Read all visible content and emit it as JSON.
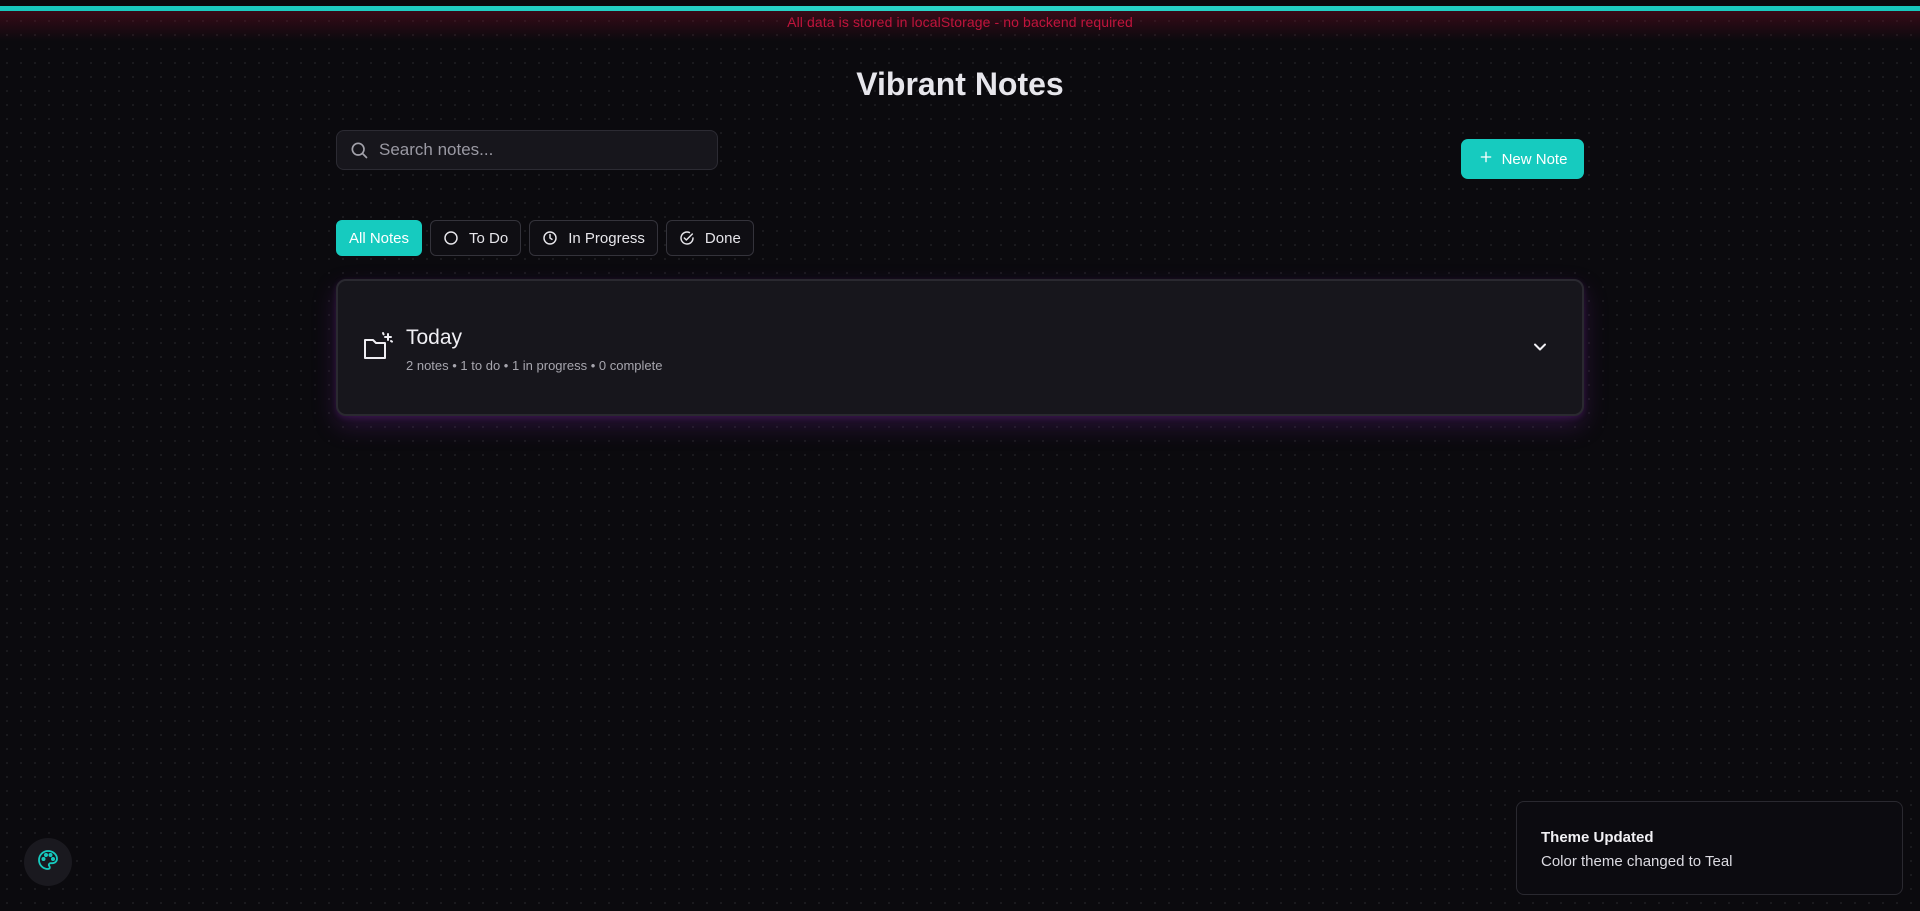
{
  "banner": {
    "storage_note": "All data is stored in localStorage - no backend required"
  },
  "header": {
    "title": "Vibrant Notes"
  },
  "search": {
    "placeholder": "Search notes...",
    "value": ""
  },
  "toolbar": {
    "new_note_label": "New Note"
  },
  "filters": [
    {
      "label": "All Notes",
      "active": true
    },
    {
      "label": "To Do",
      "icon": "circle-icon"
    },
    {
      "label": "In Progress",
      "icon": "clock-icon"
    },
    {
      "label": "Done",
      "icon": "check-circle-icon"
    }
  ],
  "groups": [
    {
      "title": "Today",
      "meta": "2 notes • 1 to do • 1 in progress • 0 complete",
      "icon": "folder-sparkle-icon"
    }
  ],
  "toast": {
    "title": "Theme Updated",
    "message": "Color theme changed to Teal"
  },
  "colors": {
    "accent": "#16cbbf",
    "banner_text": "#c0143c",
    "background": "#0b0a0e"
  },
  "icons": {
    "theme_button": "palette-icon"
  }
}
